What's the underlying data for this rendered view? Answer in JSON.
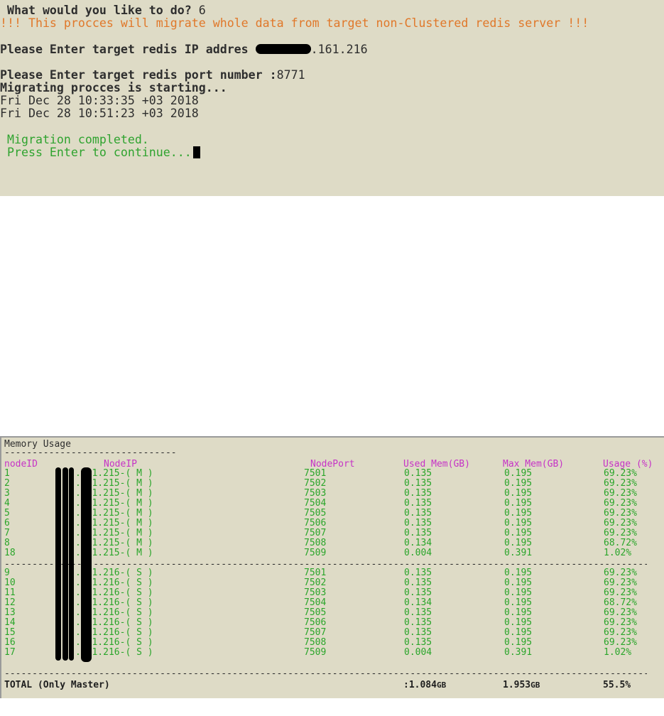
{
  "terminal_top": {
    "prompt": " What would you like to do? ",
    "choice": "6",
    "warning": "!!! This procces will migrate whole data from target non-Clustered redis server !!!",
    "ip_prompt": "Please Enter target redis IP addres ",
    "ip_suffix": ".161.216",
    "port_prompt": "Please Enter target redis port number :",
    "port_value": "8771",
    "starting": "Migrating procces is starting...",
    "time_start": "Fri Dec 28 10:33:35 +03 2018",
    "time_end": "Fri Dec 28 10:51:23 +03 2018",
    "completed": " Migration completed.",
    "press_enter": " Press Enter to continue..."
  },
  "memory": {
    "title": "Memory Usage",
    "title_rule": "-------------------------------",
    "headers": {
      "node_id": "nodeID",
      "node_ip": "NodeIP",
      "node_port": "NodePort",
      "used_mem": "Used Mem(GB)",
      "max_mem": "Max Mem(GB)",
      "usage": "Usage (%)"
    },
    "masters": [
      {
        "id": "1",
        "ip": ".161.215-( M )",
        "port": "7501",
        "used": "0.135",
        "max": "0.195",
        "usage": "69.23%"
      },
      {
        "id": "2",
        "ip": ".161.215-( M )",
        "port": "7502",
        "used": "0.135",
        "max": "0.195",
        "usage": "69.23%"
      },
      {
        "id": "3",
        "ip": ".161.215-( M )",
        "port": "7503",
        "used": "0.135",
        "max": "0.195",
        "usage": "69.23%"
      },
      {
        "id": "4",
        "ip": ".161.215-( M )",
        "port": "7504",
        "used": "0.135",
        "max": "0.195",
        "usage": "69.23%"
      },
      {
        "id": "5",
        "ip": ".161.215-( M )",
        "port": "7505",
        "used": "0.135",
        "max": "0.195",
        "usage": "69.23%"
      },
      {
        "id": "6",
        "ip": ".161.215-( M )",
        "port": "7506",
        "used": "0.135",
        "max": "0.195",
        "usage": "69.23%"
      },
      {
        "id": "7",
        "ip": ".161.215-( M )",
        "port": "7507",
        "used": "0.135",
        "max": "0.195",
        "usage": "69.23%"
      },
      {
        "id": "8",
        "ip": ".161.215-( M )",
        "port": "7508",
        "used": "0.134",
        "max": "0.195",
        "usage": "68.72%"
      },
      {
        "id": "18",
        "ip": ".161.215-( M )",
        "port": "7509",
        "used": "0.004",
        "max": "0.391",
        "usage": "1.02%"
      }
    ],
    "slaves": [
      {
        "id": "9",
        "ip": ".161.216-( S )",
        "port": "7501",
        "used": "0.135",
        "max": "0.195",
        "usage": "69.23%"
      },
      {
        "id": "10",
        "ip": ".161.216-( S )",
        "port": "7502",
        "used": "0.135",
        "max": "0.195",
        "usage": "69.23%"
      },
      {
        "id": "11",
        "ip": ".161.216-( S )",
        "port": "7503",
        "used": "0.135",
        "max": "0.195",
        "usage": "69.23%"
      },
      {
        "id": "12",
        "ip": ".161.216-( S )",
        "port": "7504",
        "used": "0.134",
        "max": "0.195",
        "usage": "68.72%"
      },
      {
        "id": "13",
        "ip": ".161.216-( S )",
        "port": "7505",
        "used": "0.135",
        "max": "0.195",
        "usage": "69.23%"
      },
      {
        "id": "14",
        "ip": ".161.216-( S )",
        "port": "7506",
        "used": "0.135",
        "max": "0.195",
        "usage": "69.23%"
      },
      {
        "id": "15",
        "ip": ".161.216-( S )",
        "port": "7507",
        "used": "0.135",
        "max": "0.195",
        "usage": "69.23%"
      },
      {
        "id": "16",
        "ip": ".161.216-( S )",
        "port": "7508",
        "used": "0.135",
        "max": "0.195",
        "usage": "69.23%"
      },
      {
        "id": "17",
        "ip": ".161.216-( S )",
        "port": "7509",
        "used": "0.004",
        "max": "0.391",
        "usage": "1.02%"
      }
    ],
    "separator": "------------------------------------------------------------------------------------------------------------------------------------------------",
    "total": {
      "label": "TOTAL (Only Master)",
      "used": ":1.084",
      "used_unit": "GB",
      "max": "1.953",
      "max_unit": "GB",
      "usage": "55.5%"
    }
  }
}
